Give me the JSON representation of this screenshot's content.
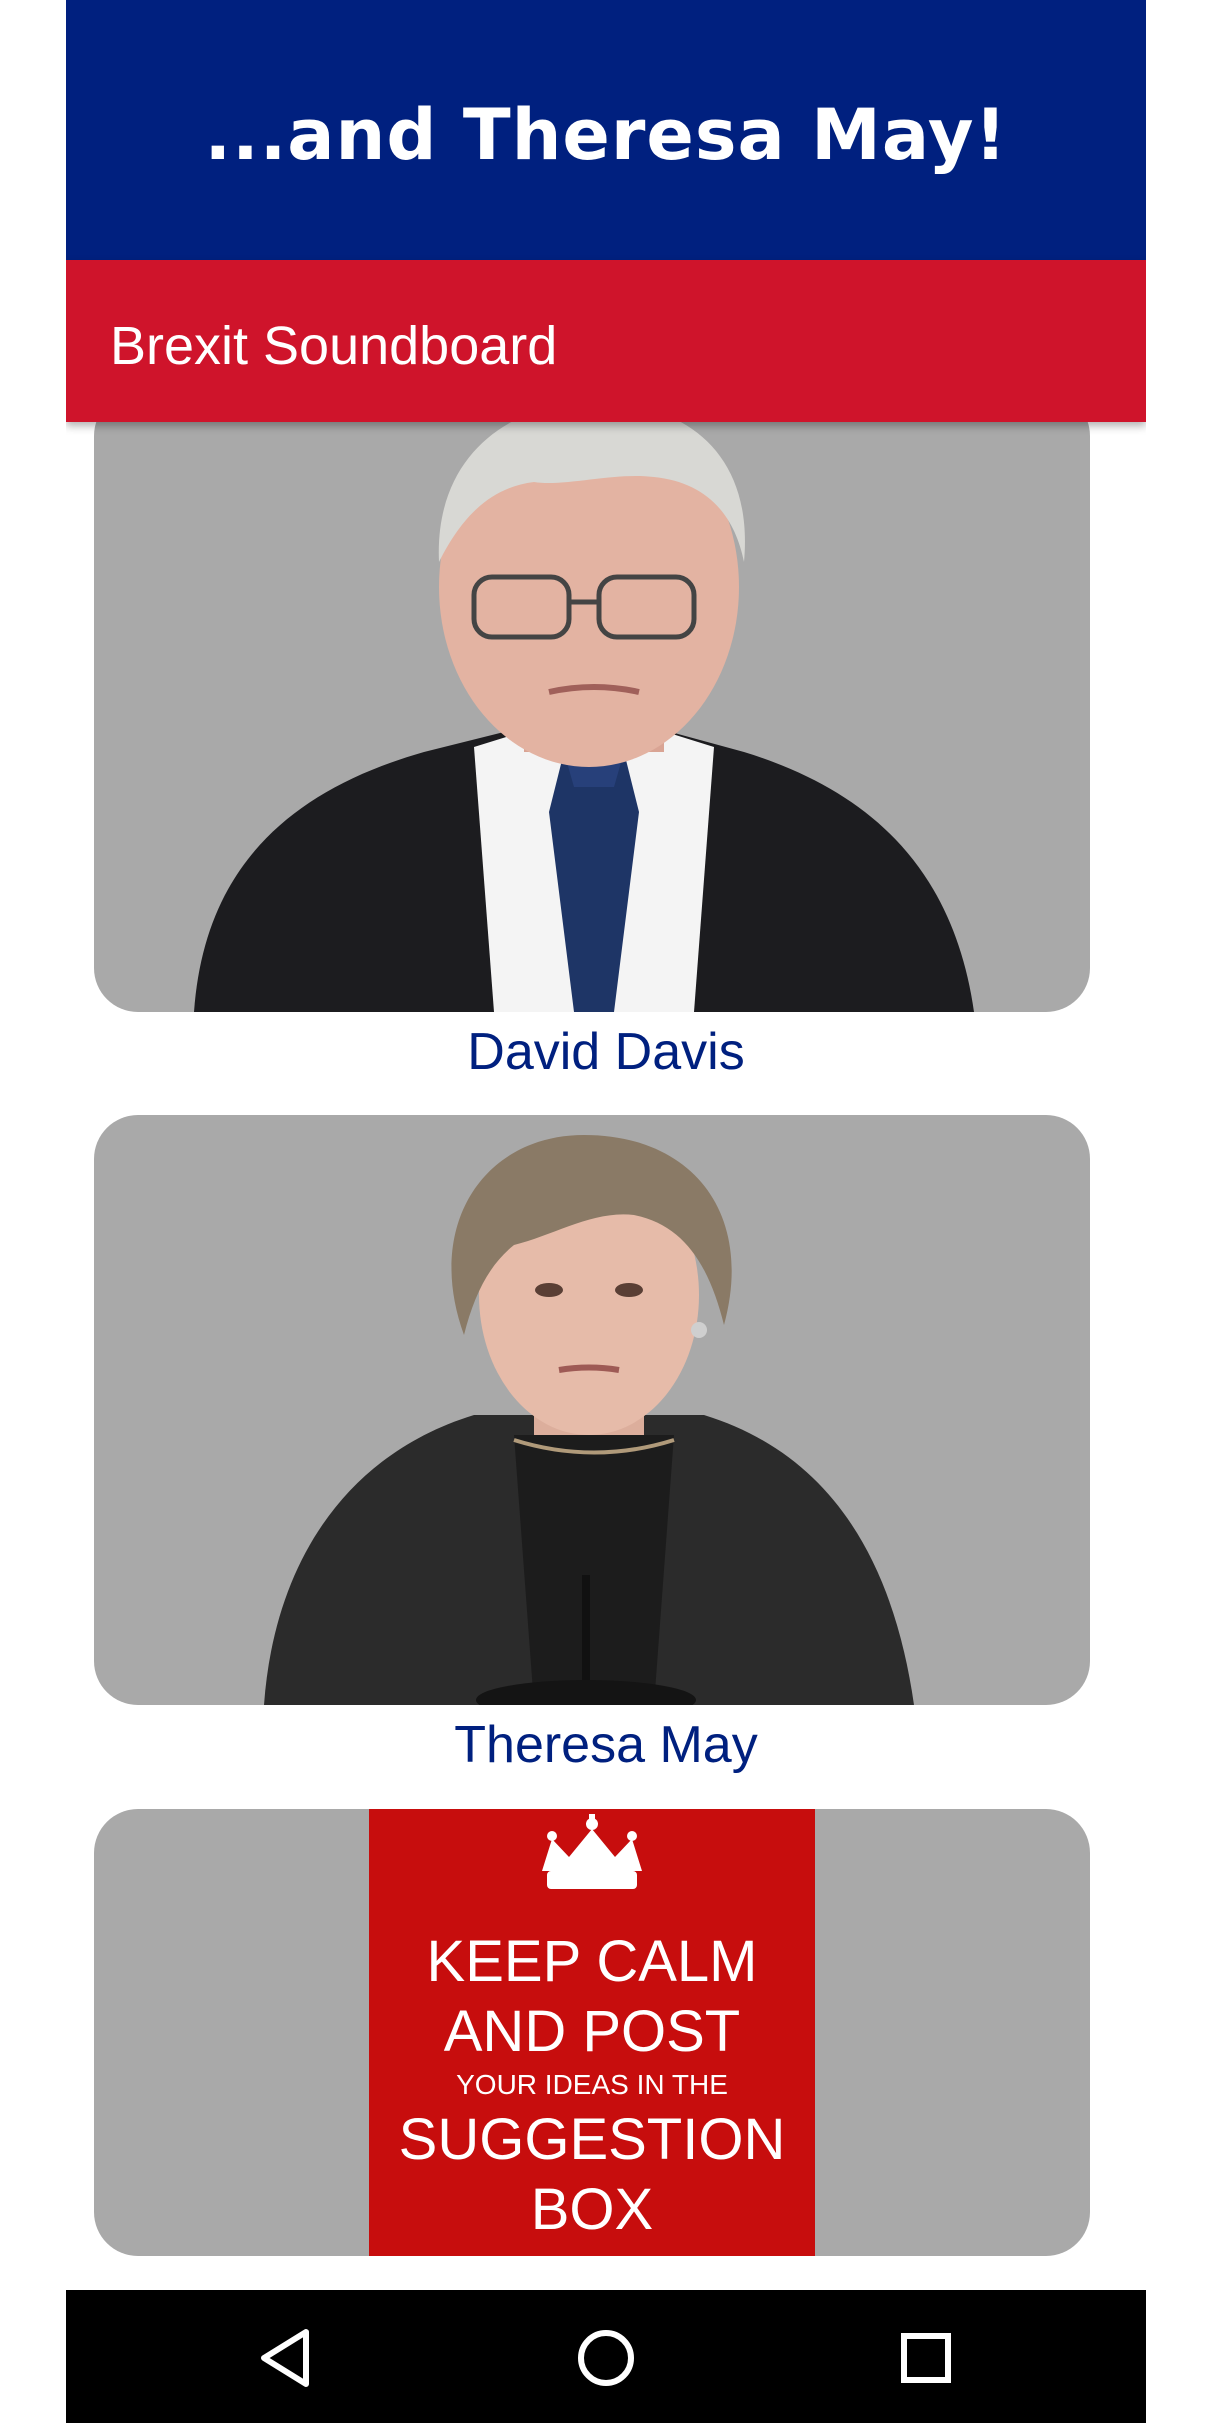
{
  "banner": {
    "text": "...and Theresa May!"
  },
  "app_bar": {
    "title": "Brexit Soundboard"
  },
  "cards": [
    {
      "caption": "David Davis",
      "image": "david-davis-photo"
    },
    {
      "caption": "Theresa May",
      "image": "theresa-may-photo"
    },
    {
      "caption": "",
      "image": "keep-calm-poster"
    }
  ],
  "poster": {
    "line1": "KEEP CALM",
    "line2": "AND POST",
    "line3": "YOUR IDEAS IN THE",
    "line4": "SUGGESTION",
    "line5": "BOX"
  },
  "nav": {
    "back_icon": "back-triangle-icon",
    "home_icon": "home-circle-icon",
    "recents_icon": "recents-square-icon"
  },
  "colors": {
    "banner_blue": "#00207f",
    "app_bar_red": "#cf142b",
    "card_gray": "#a9a9a9",
    "poster_red": "#c70d0d"
  }
}
